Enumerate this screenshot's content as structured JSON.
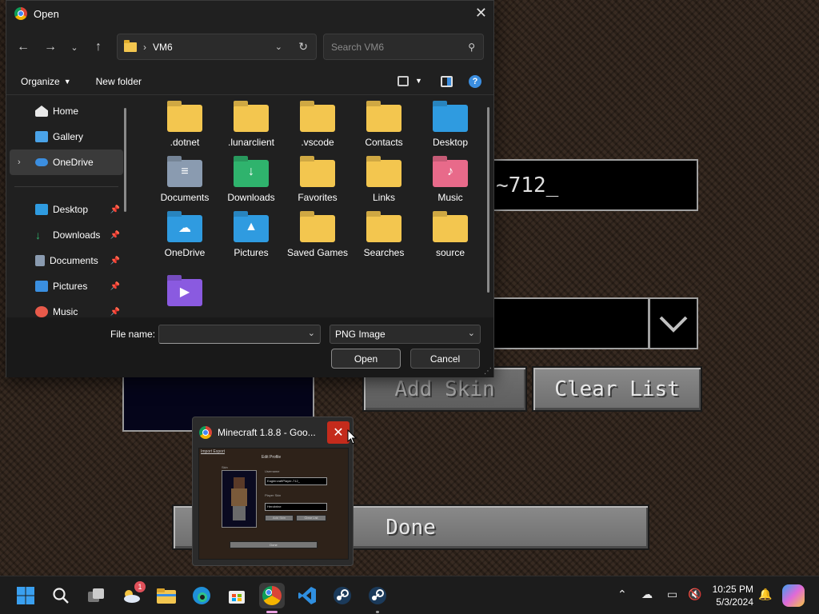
{
  "background": {
    "username_field_value": "~712_",
    "add_skin_label": "Add Skin",
    "clear_list_label": "Clear List",
    "done_label": "Done"
  },
  "dialog": {
    "title": "Open",
    "address": {
      "separator": "›",
      "folder": "VM6"
    },
    "search_placeholder": "Search VM6",
    "toolbar": {
      "organize": "Organize",
      "new_folder": "New folder"
    },
    "sidebar": [
      {
        "label": "Home",
        "icon": "home-icon",
        "color": "#e8e8e8"
      },
      {
        "label": "Gallery",
        "icon": "gallery-icon",
        "color": "#4aa3e8"
      },
      {
        "label": "OneDrive",
        "icon": "onedrive-icon",
        "color": "#3b8ee0"
      },
      {
        "label": "Desktop",
        "icon": "desktop-icon",
        "color": "#2f9be0"
      },
      {
        "label": "Downloads",
        "icon": "downloads-icon",
        "color": "#2fb36d"
      },
      {
        "label": "Documents",
        "icon": "documents-icon",
        "color": "#8a9bb0"
      },
      {
        "label": "Pictures",
        "icon": "pictures-icon",
        "color": "#3a8fe0"
      },
      {
        "label": "Music",
        "icon": "music-icon",
        "color": "#e85a4a"
      }
    ],
    "files": [
      {
        "name": ".dotnet",
        "color": "#f3c64f",
        "glyph": ""
      },
      {
        "name": ".lunarclient",
        "color": "#f3c64f",
        "glyph": ""
      },
      {
        "name": ".vscode",
        "color": "#f3c64f",
        "glyph": ""
      },
      {
        "name": "Contacts",
        "color": "#f3c64f",
        "glyph": ""
      },
      {
        "name": "Desktop",
        "color": "#2f9be0",
        "glyph": ""
      },
      {
        "name": "Documents",
        "color": "#8a9bb0",
        "glyph": "≡"
      },
      {
        "name": "Downloads",
        "color": "#2fb36d",
        "glyph": "↓"
      },
      {
        "name": "Favorites",
        "color": "#f3c64f",
        "glyph": ""
      },
      {
        "name": "Links",
        "color": "#f3c64f",
        "glyph": ""
      },
      {
        "name": "Music",
        "color": "#e86a8a",
        "glyph": "♪"
      },
      {
        "name": "OneDrive",
        "color": "#2f9be0",
        "glyph": "☁"
      },
      {
        "name": "Pictures",
        "color": "#2f9be0",
        "glyph": "▲"
      },
      {
        "name": "Saved Games",
        "color": "#f3c64f",
        "glyph": ""
      },
      {
        "name": "Searches",
        "color": "#f3c64f",
        "glyph": ""
      },
      {
        "name": "source",
        "color": "#f3c64f",
        "glyph": ""
      },
      {
        "name": "",
        "color": "#8a5ae0",
        "glyph": "▶"
      }
    ],
    "file_name_label": "File name:",
    "file_name_value": "",
    "file_type": "PNG Image",
    "open_label": "Open",
    "cancel_label": "Cancel"
  },
  "preview": {
    "title": "Minecraft 1.8.8 - Goo...",
    "thumb": {
      "link": "Import Export",
      "heading": "Edit Profile",
      "skin": "Skin",
      "username_label": "Username",
      "username_value": "EaglercraftPlayer-712_",
      "player_skin_label": "Player Skin",
      "player_skin_value": "Herobrine",
      "add_skin": "Add Skin",
      "clear_list": "Clear List",
      "done": "Done"
    }
  },
  "taskbar": {
    "notification_count": "1",
    "time": "10:25 PM",
    "date": "5/3/2024"
  }
}
